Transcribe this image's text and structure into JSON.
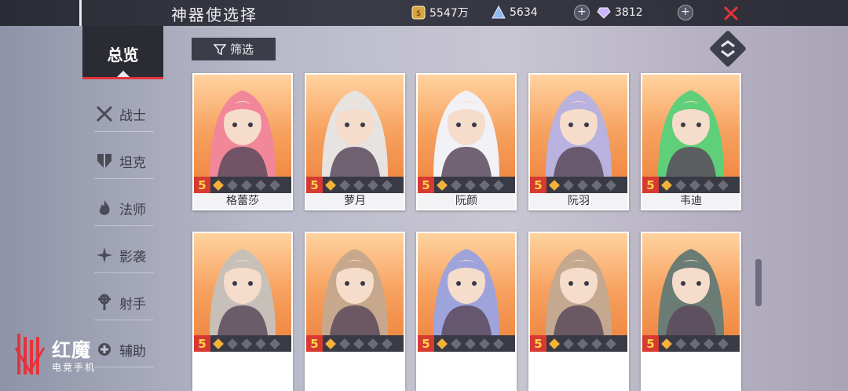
{
  "header": {
    "title": "神器使选择",
    "gold": "5547万",
    "crystal": "5634",
    "gem": "3812"
  },
  "sidebar": {
    "selected": "总览",
    "items": [
      {
        "label": "战士",
        "icon": "crossed-swords-icon"
      },
      {
        "label": "坦克",
        "icon": "shield-icon"
      },
      {
        "label": "法师",
        "icon": "flame-icon"
      },
      {
        "label": "影袭",
        "icon": "shuriken-icon"
      },
      {
        "label": "射手",
        "icon": "crosshair-icon"
      },
      {
        "label": "辅助",
        "icon": "support-icon"
      }
    ]
  },
  "toolbar": {
    "filter_label": "筛选"
  },
  "cards": [
    {
      "name": "格蕾莎",
      "rank": "5",
      "hair": "#f2879a"
    },
    {
      "name": "萝月",
      "rank": "5",
      "hair": "#e6e3e0"
    },
    {
      "name": "阮颜",
      "rank": "5",
      "hair": "#f1f1f6"
    },
    {
      "name": "阮羽",
      "rank": "5",
      "hair": "#b9b1de"
    },
    {
      "name": "韦迪",
      "rank": "5",
      "hair": "#5fcf7a"
    },
    {
      "name": "",
      "rank": "5",
      "hair": "#c7c0b8"
    },
    {
      "name": "",
      "rank": "5",
      "hair": "#c8a88c"
    },
    {
      "name": "",
      "rank": "5",
      "hair": "#9fa3dc"
    },
    {
      "name": "",
      "rank": "5",
      "hair": "#c4a890"
    },
    {
      "name": "",
      "rank": "5",
      "hair": "#6b7c74"
    }
  ],
  "watermark": {
    "brand": "红魔",
    "sub": "电竞手机"
  }
}
